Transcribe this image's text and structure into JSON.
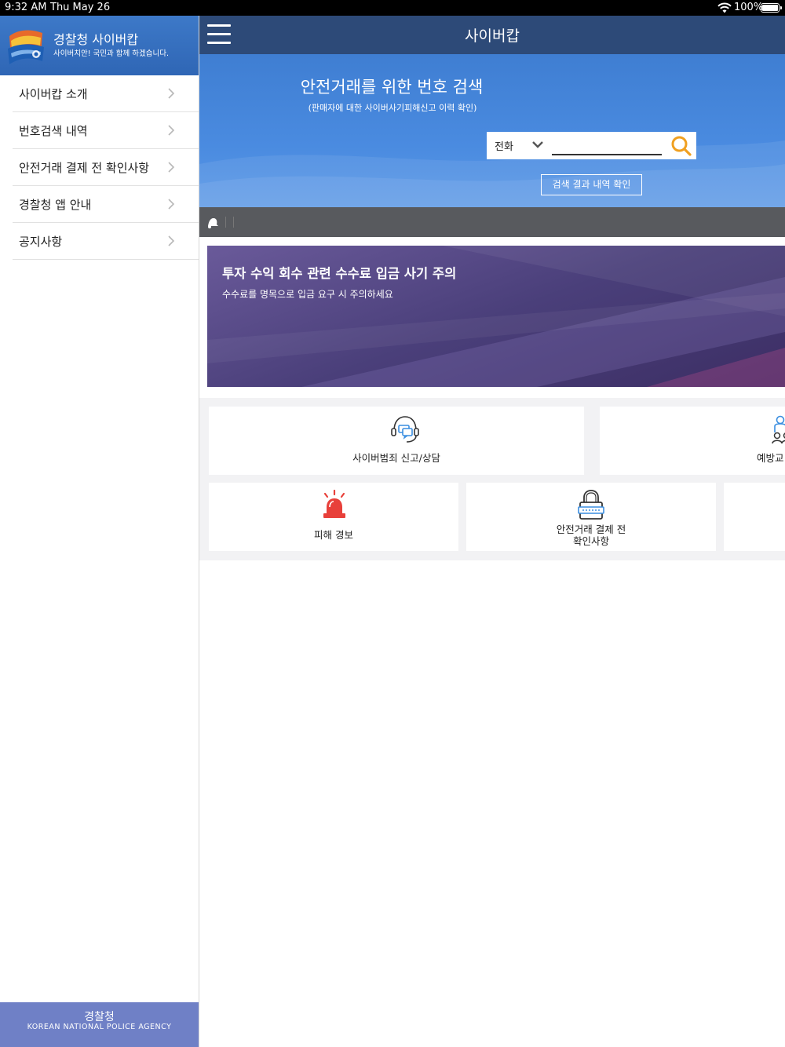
{
  "status_bar": {
    "time": "9:32 AM",
    "date": "Thu May 26",
    "battery": "100%",
    "icons": [
      "wifi-icon",
      "battery-icon"
    ]
  },
  "sidebar": {
    "app_title": "경찰청 사이버캅",
    "app_subtitle": "사이버치안! 국민과 함께 하겠습니다.",
    "items": [
      {
        "label": "사이버캅 소개"
      },
      {
        "label": "번호검색 내역"
      },
      {
        "label": "안전거래 결제 전 확인사항"
      },
      {
        "label": "경찰청 앱 안내"
      },
      {
        "label": "공지사항"
      }
    ],
    "footer_title": "경찰청",
    "footer_subtitle": "KOREAN NATIONAL POLICE AGENCY"
  },
  "topbar": {
    "title": "사이버캅"
  },
  "hero": {
    "title": "안전거래를 위한 번호 검색",
    "subtitle": "(판매자에 대한 사이버사기피해신고 이력 확인)",
    "search_type": "전화",
    "search_value": "",
    "result_button": "검색 결과 내역 확인"
  },
  "banner": {
    "title": "투자 수익 회수 관련 수수료 입금 사기 주의",
    "subtitle": "수수료를 명목으로 입금 요구 시 주의하세요"
  },
  "tiles": [
    {
      "label": "사이버범죄 신고/상담",
      "icon": "headset-chat-icon"
    },
    {
      "label": "예방교",
      "icon": "people-icon"
    },
    {
      "label": "피해 경보",
      "icon": "siren-icon"
    },
    {
      "label_line1": "안전거래 결제 전",
      "label_line2": "확인사항",
      "icon": "lock-icon"
    }
  ],
  "colors": {
    "header_blue": "#2d4a78",
    "hero_blue": "#4a8be0",
    "sidebar_header": "#3470bf",
    "footer_purple": "#6f80c6",
    "banner_purple": "#4a3f7a",
    "search_orange": "#f0a020",
    "siren_red": "#e8403a",
    "icon_blue": "#3a8ee0"
  }
}
